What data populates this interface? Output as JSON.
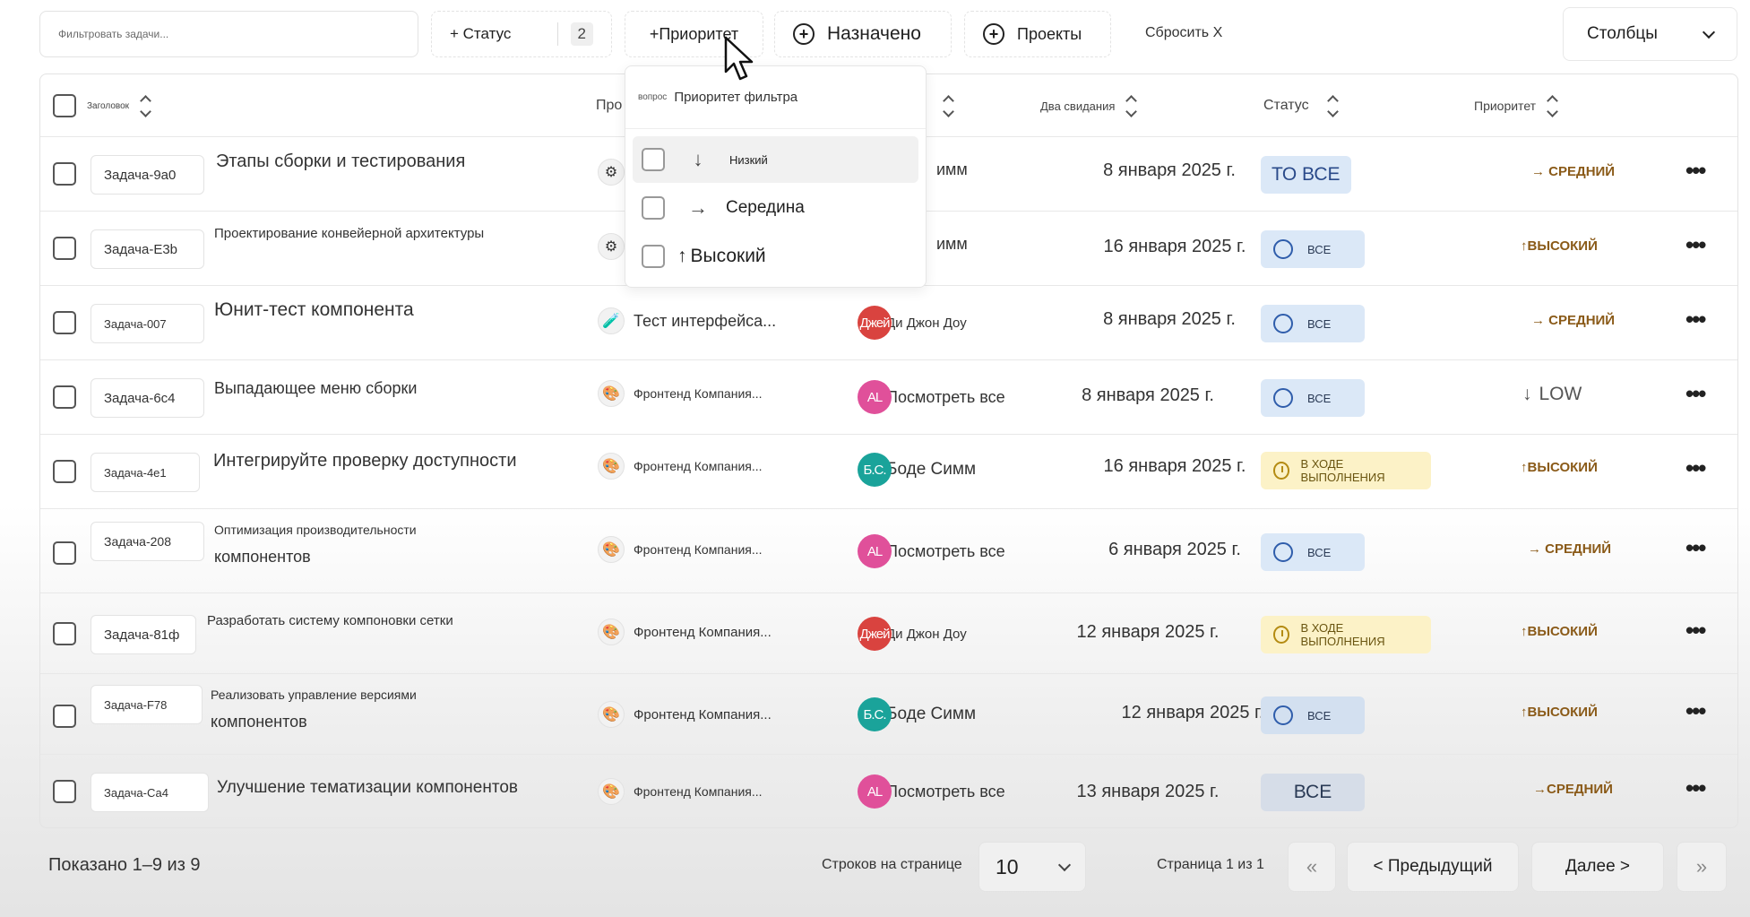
{
  "toolbar": {
    "filter_placeholder": "Фильтровать задачи...",
    "status_label": "+ Статус",
    "status_count": "2",
    "priority_label": "+Приоритет",
    "assigned_label": "Назначено",
    "projects_label": "Проекты",
    "reset_label": "Сбросить X",
    "columns_label": "Столбцы"
  },
  "columns": {
    "title": "Заголовок",
    "project": "Про",
    "date": "Два свидания",
    "status": "Статус",
    "priority": "Приоритет"
  },
  "dropdown": {
    "prefix": "вопрос",
    "title": "Приоритет фильтра",
    "options": [
      {
        "label": "Низкий",
        "icon": "↓"
      },
      {
        "label": "Середина",
        "icon": "→"
      },
      {
        "label": "Высокий",
        "icon": "↑"
      }
    ]
  },
  "rows": [
    {
      "id": "Задача-9а0",
      "title": "Этапы сборки и тестирования",
      "project": "",
      "assignee_initials": "",
      "assignee": "имм",
      "date": "8 января 2025 г.",
      "status": "ТО ВСЕ",
      "priority": "→ СРЕДНИЙ"
    },
    {
      "id": "Задача-E3b",
      "title": "Проектирование конвейерной архитектуры",
      "project": "",
      "assignee_initials": "",
      "assignee": "имм",
      "date": "16 января 2025 г.",
      "status": "ВСЕ",
      "priority": "↑ВЫСОКИЙ"
    },
    {
      "id": "Задача-007",
      "title": "Юнит-тест компонента",
      "project": "Тест интерфейса...",
      "assignee_initials": "Джей",
      "assignee": "Ди Джон Доу",
      "date": "8 января 2025 г.",
      "status": "ВСЕ",
      "priority": "→ СРЕДНИЙ"
    },
    {
      "id": "Задача-6с4",
      "title": "Выпадающее меню сборки",
      "project": "Фронтенд Компания...",
      "assignee_initials": "AL",
      "assignee": "Посмотреть все",
      "date": "8 января 2025 г.",
      "status": "ВСЕ",
      "priority": "LOW"
    },
    {
      "id": "Задача-4е1",
      "title": "Интегрируйте проверку доступности",
      "project": "Фронтенд Компания...",
      "assignee_initials": "Б.С.",
      "assignee": "Боде Симм",
      "date": "16 января 2025 г.",
      "status": "В ХОДЕ ВЫПОЛНЕНИЯ",
      "priority": "↑ВЫСОКИЙ"
    },
    {
      "id": "Задача-208",
      "title": "Оптимизация производительности",
      "title2": "компонентов",
      "project": "Фронтенд Компания...",
      "assignee_initials": "AL",
      "assignee": "Посмотреть все",
      "date": "6 января 2025 г.",
      "status": "ВСЕ",
      "priority": "→ СРЕДНИЙ"
    },
    {
      "id": "Задача-81ф",
      "title": "Разработать систему компоновки сетки",
      "project": "Фронтенд Компания...",
      "assignee_initials": "Джей",
      "assignee": "Ди Джон Доу",
      "date": "12 января 2025 г.",
      "status": "В ХОДЕ ВЫПОЛНЕНИЯ",
      "priority": "↑ВЫСОКИЙ"
    },
    {
      "id": "Задача-F78",
      "title": "Реализовать управление версиями",
      "title2": "компонентов",
      "project": "Фронтенд Компания...",
      "assignee_initials": "Б.С.",
      "assignee": "Боде Симм",
      "date": "12 января 2025 г.",
      "status": "ВСЕ",
      "priority": "↑ВЫСОКИЙ"
    },
    {
      "id": "Задача-Са4",
      "title": "Улучшение тематизации компонентов",
      "project": "Фронтенд Компания...",
      "assignee_initials": "AL",
      "assignee": "Посмотреть все",
      "date": "13 января 2025 г.",
      "status": "ВСЕ",
      "priority": "→СРЕДНИЙ"
    }
  ],
  "footer": {
    "count_text": "Показано 1–9 из 9",
    "rows_label": "Строков на странице",
    "rows_value": "10",
    "page_info": "Страница 1 из 1",
    "first_label": "«",
    "prev_label": "< Предыдущий",
    "next_label": "Далее >",
    "last_label": "»"
  },
  "colors": {
    "status_blue": "#dbe8f7",
    "status_yellow": "#fcf2c7",
    "priority_text": "#8a5a18",
    "avatar_red": "#d9433f",
    "avatar_pink": "#e0509a",
    "avatar_teal": "#1aa39a"
  }
}
